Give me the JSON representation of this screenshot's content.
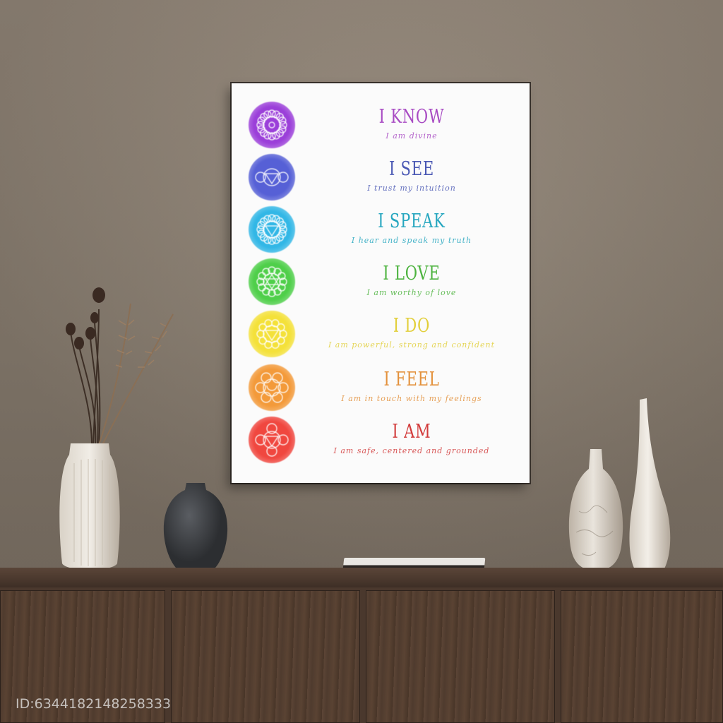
{
  "poster": {
    "rows": [
      {
        "title": "I KNOW",
        "subtitle": "I am divine",
        "color": "#a84bc3",
        "circle": "#9b3fd9"
      },
      {
        "title": "I SEE",
        "subtitle": "I trust my intuition",
        "color": "#4a58b4",
        "circle": "#5660d6"
      },
      {
        "title": "I SPEAK",
        "subtitle": "I hear and speak my truth",
        "color": "#25a6bf",
        "circle": "#32b7e6"
      },
      {
        "title": "I LOVE",
        "subtitle": "I am worthy of love",
        "color": "#4db33f",
        "circle": "#4fcf4a"
      },
      {
        "title": "I DO",
        "subtitle": "I am powerful, strong and confident",
        "color": "#e2cf3b",
        "circle": "#f4e13a"
      },
      {
        "title": "I FEEL",
        "subtitle": "I am in touch with my feelings",
        "color": "#e3913c",
        "circle": "#f39a3a"
      },
      {
        "title": "I AM",
        "subtitle": "I am safe, centered and grounded",
        "color": "#d23b3b",
        "circle": "#f0473f"
      }
    ]
  },
  "watermark": "ID:6344182148258333",
  "icons": [
    "crown-chakra-icon",
    "third-eye-chakra-icon",
    "throat-chakra-icon",
    "heart-chakra-icon",
    "solar-plexus-chakra-icon",
    "sacral-chakra-icon",
    "root-chakra-icon"
  ]
}
